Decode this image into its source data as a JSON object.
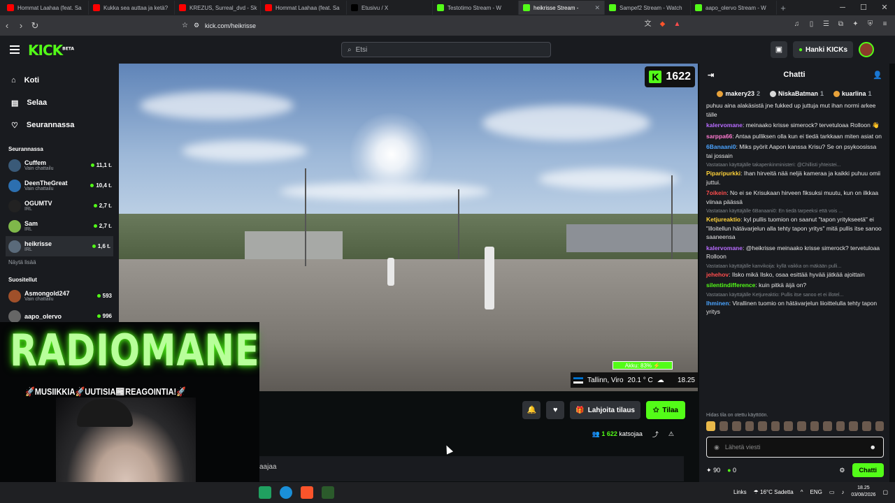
{
  "browser": {
    "tabs": [
      {
        "label": "Hommat Laahaa (feat. Sa",
        "color": "#ff0000"
      },
      {
        "label": "Kukka sea auttaa ja ketä?",
        "color": "#ff0000"
      },
      {
        "label": "KREZUS, Surreal_dvd - Sk",
        "color": "#ff0000"
      },
      {
        "label": "Hommat Laahaa (feat. Sa",
        "color": "#ff0000"
      },
      {
        "label": "Etusivu / X",
        "color": "#000000"
      },
      {
        "label": "Testotimo Stream - W",
        "color": "#53fc18"
      },
      {
        "label": "heikrisse Stream -",
        "color": "#53fc18",
        "active": true
      },
      {
        "label": "Sampef2 Stream - Watch",
        "color": "#53fc18"
      },
      {
        "label": "aapo_olervo Stream - W",
        "color": "#53fc18"
      }
    ],
    "url": "kick.com/heikrisse"
  },
  "topnav": {
    "logo": "KICK",
    "logo_badge": "BETA",
    "search_placeholder": "Etsi",
    "get_kicks": "Hanki KICKs"
  },
  "sidebar": {
    "main": [
      {
        "label": "Koti",
        "icon": "home-icon"
      },
      {
        "label": "Selaa",
        "icon": "browse-icon"
      },
      {
        "label": "Seurannassa",
        "icon": "heart-icon"
      }
    ],
    "following_title": "Seurannassa",
    "following": [
      {
        "name": "Cuffem",
        "category": "Vain chattailu",
        "viewers": "11,1 t.",
        "color": "#3a5a78"
      },
      {
        "name": "DeenTheGreat",
        "category": "Vain chattailu",
        "viewers": "10,4 t.",
        "color": "#2c6fb0"
      },
      {
        "name": "OGUMTV",
        "category": "IRL",
        "viewers": "2,7 t.",
        "color": "#222"
      },
      {
        "name": "Sam",
        "category": "IRL",
        "viewers": "2,7 t.",
        "color": "#7fb84a"
      },
      {
        "name": "heikrisse",
        "category": "IRL",
        "viewers": "1,6 t.",
        "color": "#5a6a7a",
        "selected": true
      }
    ],
    "show_more": "Näytä lisää",
    "recommended_title": "Suositellut",
    "recommended": [
      {
        "name": "Asmongold247",
        "category": "Vain chattailu",
        "viewers": "593",
        "color": "#a0502a"
      },
      {
        "name": "aapo_olervo",
        "category": "",
        "viewers": "996",
        "color": "#666"
      }
    ]
  },
  "video": {
    "viewer_badge": "1622",
    "battery": "Akku: 83% ⚡",
    "location": "Tallinn, Viro",
    "temperature": "20.1 ° C",
    "time": "18.25"
  },
  "overlay": {
    "title": "RADIOMANE",
    "subtitle": "🚀MUSIIKKIA🚀UUTISIA📰REAGOINTIA!🚀"
  },
  "stream_actions": {
    "gift_sub": "Lahjoita tilaus",
    "subscribe": "Tilaa",
    "viewers_count": "1 622",
    "viewers_label": "katsojaa",
    "about_text": "aajaa"
  },
  "chat": {
    "title": "Chatti",
    "pinned": [
      {
        "name": "makery23",
        "count": "2",
        "color": "#e8a23a"
      },
      {
        "name": "NiskaBatman",
        "count": "1",
        "color": "#d8d8d8"
      },
      {
        "name": "kuarlina",
        "count": "1",
        "color": "#e8a23a"
      }
    ],
    "messages": [
      {
        "reply": "",
        "user": "",
        "color": "#e6e6e6",
        "text": "puhuu aina alakäsistä jne fukked up juttuja mut ihan normi arkee tälle"
      },
      {
        "reply": "",
        "user": "kalervomane",
        "color": "#b86bff",
        "text": ": meinaako krisse simerock? tervetuloaa Rolloon 👋"
      },
      {
        "reply": "",
        "user": "sarppa66",
        "color": "#ff7ad1",
        "text": ": Antaa pulliksen olla kun ei tiedä tarkkaan miten asiat on"
      },
      {
        "reply": "",
        "user": "6Banaani0",
        "color": "#4aa3ff",
        "text": ": Miks pyörit Aapon kanssa Krisu? Se on psykoosissa tai jossain"
      },
      {
        "reply": "Vastataan käyttäjälle takapenkinministeri: @Chillisti yhteistei...",
        "user": "Piparipurkki",
        "color": "#ffd23a",
        "text": ": Ihan hirveitä nää neljä kameraa ja kaikki puhuu omii juttui."
      },
      {
        "reply": "",
        "user": "7oikein",
        "color": "#ff4d4d",
        "text": ": No ei se Krisukaan hirveen fiksuksi muutu, kun on ilkkaa viinaa päässä"
      },
      {
        "reply": "Vastataan käyttäjälle 6Banaani0: En tiedä tarpeeksi että vois ...",
        "user": "Ketjureaktio",
        "color": "#ffd23a",
        "text": ": kyl pullis tuomion on saanut \"tapon yritykseetä\" ei \"illoitellun hätävarjelun alla tehty tapon yritys\" mitä pullis itse sanoo saaneensa"
      },
      {
        "reply": "",
        "user": "kalervomane",
        "color": "#b86bff",
        "text": ": @heikrisse meinaako krisse simerock? tervetuloaa Rolloon"
      },
      {
        "reply": "Vastataan käyttäjälle kanvikoija: kyllä vaikka on mäkään pulli...",
        "user": "jehehov",
        "color": "#ff4d4d",
        "text": ": Ilsko mikä Ilsko, osaa esittää hyvää jätkää ajoittain"
      },
      {
        "reply": "",
        "user": "silentindifference",
        "color": "#53fc18",
        "text": ": kuin pitkä äijä on?"
      },
      {
        "reply": "Vastataan käyttäjälle Ketjureaktio: Pullis itse sanoo et ei illotel...",
        "user": "Ihminen",
        "color": "#4aa3ff",
        "text": ": Virallinen tuomio on hätävarjelun liioittelulla tehty tapon yritys"
      }
    ],
    "slow_mode": "Hidas tila on otettu käyttöön.",
    "input_placeholder": "Lähetä viesti",
    "points": "90",
    "kicks": "0",
    "send_button": "Chatti"
  },
  "taskbar": {
    "links": "Links",
    "weather": "16°C Sadetta",
    "lang": "ENG",
    "time": "18.25",
    "date": "03/08/2026"
  }
}
